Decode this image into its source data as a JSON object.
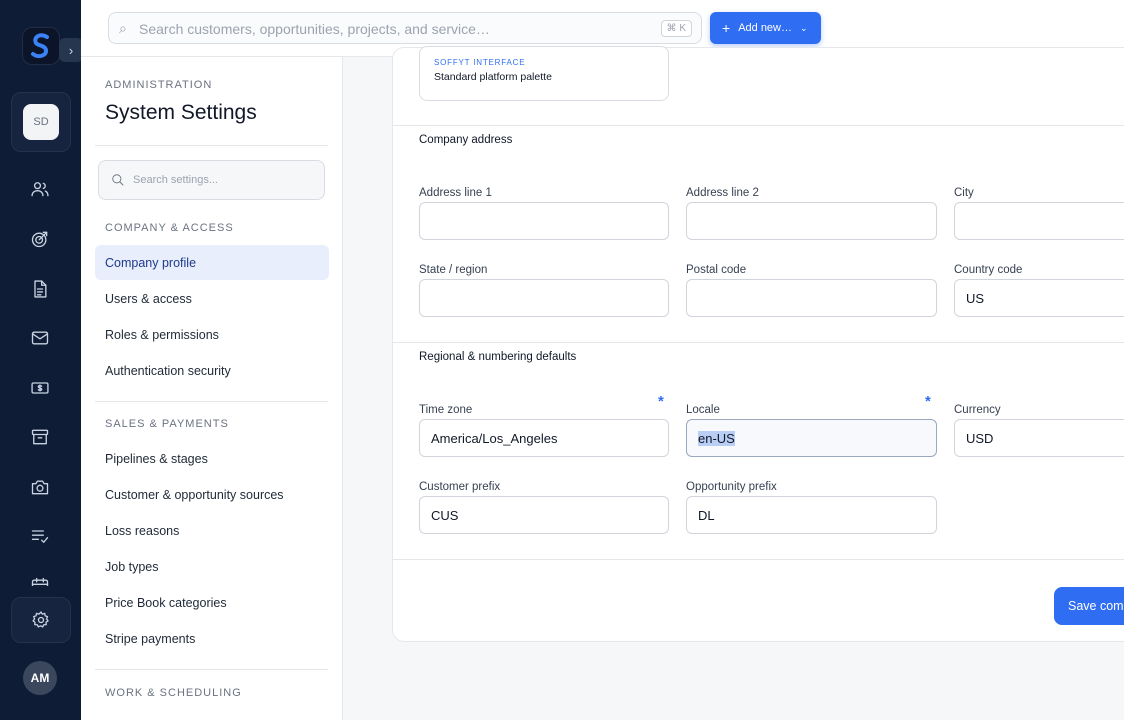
{
  "rail": {
    "workspace_initials": "SD",
    "user_initials": "AM",
    "icons": [
      "users-icon",
      "target-icon",
      "document-icon",
      "mail-icon",
      "money-icon",
      "archive-icon",
      "camera-icon",
      "checklist-icon",
      "calendar-icon",
      "settings-icon"
    ]
  },
  "topbar": {
    "search_placeholder": "Search customers, opportunities, projects, and service…",
    "shortcut": "⌘ K",
    "add_new_label": "Add new…"
  },
  "sidebar": {
    "eyebrow": "ADMINISTRATION",
    "title": "System Settings",
    "search_placeholder": "Search settings...",
    "groups": [
      {
        "label": "COMPANY & ACCESS",
        "items": [
          "Company profile",
          "Users & access",
          "Roles & permissions",
          "Authentication security"
        ]
      },
      {
        "label": "SALES & PAYMENTS",
        "items": [
          "Pipelines & stages",
          "Customer & opportunity sources",
          "Loss reasons",
          "Job types",
          "Price Book categories",
          "Stripe payments"
        ]
      },
      {
        "label": "WORK & SCHEDULING",
        "items": []
      }
    ],
    "active_item": "Company profile"
  },
  "main": {
    "palette": {
      "kicker": "SOFFYT INTERFACE",
      "value": "Standard platform palette"
    },
    "address": {
      "title": "Company address",
      "fields": {
        "address1": {
          "label": "Address line 1",
          "value": ""
        },
        "address2": {
          "label": "Address line 2",
          "value": ""
        },
        "city": {
          "label": "City",
          "value": ""
        },
        "state": {
          "label": "State / region",
          "value": ""
        },
        "postal": {
          "label": "Postal code",
          "value": ""
        },
        "country": {
          "label": "Country code",
          "value": "US"
        }
      }
    },
    "regional": {
      "title": "Regional & numbering defaults",
      "fields": {
        "timezone": {
          "label": "Time zone",
          "value": "America/Los_Angeles",
          "required": "*"
        },
        "locale": {
          "label": "Locale",
          "value": "en-US",
          "required": "*"
        },
        "currency": {
          "label": "Currency",
          "value": "USD"
        },
        "customer_prefix": {
          "label": "Customer prefix",
          "value": "CUS"
        },
        "opportunity_prefix": {
          "label": "Opportunity prefix",
          "value": "DL"
        }
      }
    },
    "save_label": "Save company profile"
  }
}
